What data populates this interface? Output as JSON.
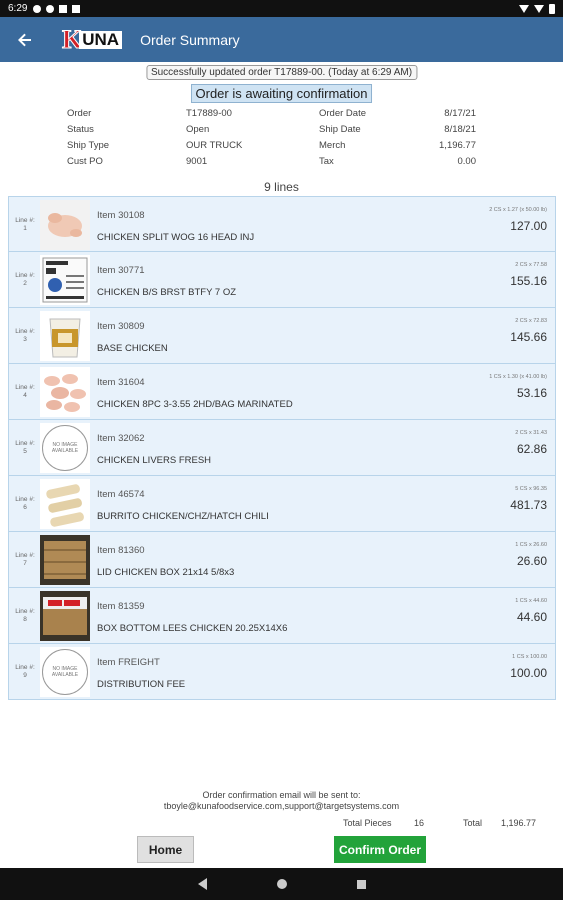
{
  "status_bar": {
    "time": "6:29"
  },
  "app_bar": {
    "logo_k": "K",
    "logo_rest": "UNA",
    "title": "Order Summary"
  },
  "messages": {
    "success": "Successfully updated order T17889-00. (Today at 6:29 AM)",
    "awaiting": "Order is awaiting confirmation"
  },
  "order_info": {
    "order_label": "Order",
    "order_value": "T17889-00",
    "order_date_label": "Order Date",
    "order_date_value": "8/17/21",
    "status_label": "Status",
    "status_value": "Open",
    "ship_date_label": "Ship Date",
    "ship_date_value": "8/18/21",
    "ship_type_label": "Ship Type",
    "ship_type_value": "OUR TRUCK",
    "merch_label": "Merch",
    "merch_value": "1,196.77",
    "cust_po_label": "Cust PO",
    "cust_po_value": "9001",
    "tax_label": "Tax",
    "tax_value": "0.00"
  },
  "lines_count": "9 lines",
  "line_label": "Line #:",
  "no_image_text": "NO IMAGE AVAILABLE",
  "items": [
    {
      "line": "1",
      "item": "Item 30108",
      "desc": "CHICKEN SPLIT WOG 16 HEAD INJ",
      "qty": "2 CS x 1.27 (x 50.00 lb)",
      "amount": "127.00",
      "image": "whole-chicken"
    },
    {
      "line": "2",
      "item": "Item 30771",
      "desc": "CHICKEN B/S BRST BTFY 7 OZ",
      "qty": "2 CS x 77.58",
      "amount": "155.16",
      "image": "chicken-box-label"
    },
    {
      "line": "3",
      "item": "Item 30809",
      "desc": "BASE CHICKEN",
      "qty": "2 CS x 72.83",
      "amount": "145.66",
      "image": "base-tub"
    },
    {
      "line": "4",
      "item": "Item 31604",
      "desc": "CHICKEN 8PC 3-3.55 2HD/BAG MARINATED",
      "qty": "1 CS x 1.30 (x 41.00 lb)",
      "amount": "53.16",
      "image": "chicken-pieces"
    },
    {
      "line": "5",
      "item": "Item 32062",
      "desc": "CHICKEN LIVERS FRESH",
      "qty": "2 CS x 31.43",
      "amount": "62.86",
      "image": "none"
    },
    {
      "line": "6",
      "item": "Item 46574",
      "desc": "BURRITO CHICKEN/CHZ/HATCH CHILI",
      "qty": "5 CS x 96.35",
      "amount": "481.73",
      "image": "burritos"
    },
    {
      "line": "7",
      "item": "Item 81360",
      "desc": "LID CHICKEN BOX 21x14 5/8x3",
      "qty": "1 CS x 26.60",
      "amount": "26.60",
      "image": "box-lid"
    },
    {
      "line": "8",
      "item": "Item 81359",
      "desc": "BOX BOTTOM LEES CHICKEN 20.25X14X6",
      "qty": "1 CS x 44.60",
      "amount": "44.60",
      "image": "box-bottom"
    },
    {
      "line": "9",
      "item": "Item FREIGHT",
      "desc": "DISTRIBUTION FEE",
      "qty": "1 CS x 100.00",
      "amount": "100.00",
      "image": "none"
    }
  ],
  "footer": {
    "email_note_line1": "Order confirmation email will be sent to:",
    "email_note_line2": "tboyle@kunafoodservice.com,support@targetsystems.com",
    "total_pieces_label": "Total Pieces",
    "total_pieces_value": "16",
    "total_label": "Total",
    "total_value": "1,196.77",
    "home_label": "Home",
    "confirm_label": "Confirm Order"
  },
  "colors": {
    "appbar": "#3a6a9c",
    "item_bg": "#e8f2fb",
    "confirm": "#22a33a"
  }
}
